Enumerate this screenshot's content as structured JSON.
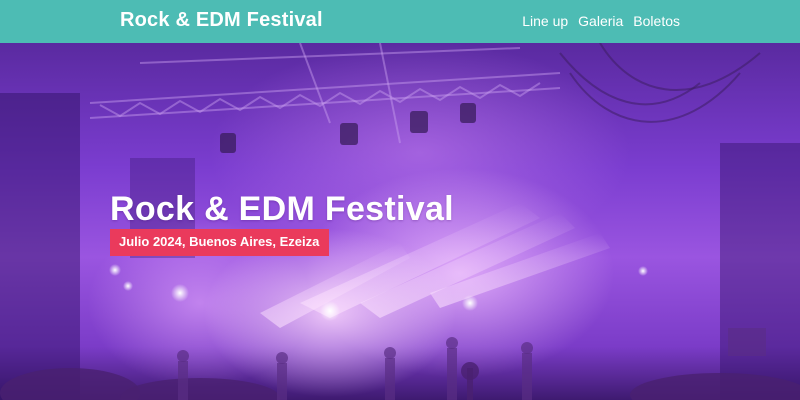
{
  "header": {
    "brand": "Rock & EDM Festival",
    "nav": [
      {
        "label": "Line up"
      },
      {
        "label": "Galeria"
      },
      {
        "label": "Boletos"
      }
    ],
    "background_color": "#4dbcb4"
  },
  "hero": {
    "title": "Rock & EDM Festival",
    "badge": "Julio 2024, Buenos Aires, Ezeiza",
    "badge_color": "#ea3a5c"
  }
}
